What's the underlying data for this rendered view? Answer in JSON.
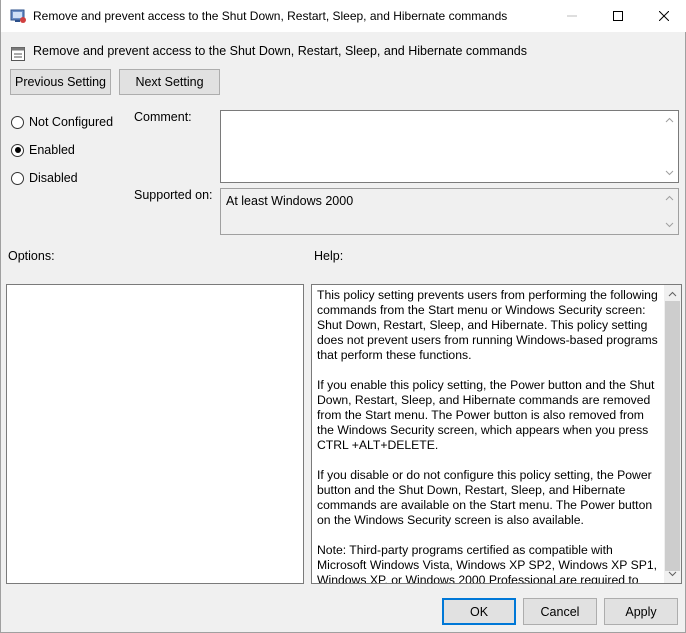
{
  "window": {
    "title": "Remove and prevent access to the Shut Down, Restart, Sleep, and Hibernate commands"
  },
  "header": {
    "title": "Remove and prevent access to the Shut Down, Restart, Sleep, and Hibernate commands"
  },
  "nav": {
    "previous_label": "Previous Setting",
    "next_label": "Next Setting"
  },
  "state": {
    "options": [
      {
        "label": "Not Configured",
        "checked": false
      },
      {
        "label": "Enabled",
        "checked": true
      },
      {
        "label": "Disabled",
        "checked": false
      }
    ]
  },
  "comment": {
    "label": "Comment:",
    "value": ""
  },
  "supported": {
    "label": "Supported on:",
    "value": "At least Windows 2000"
  },
  "options_panel": {
    "label": "Options:"
  },
  "help": {
    "label": "Help:",
    "paragraphs": [
      "This policy setting prevents users from performing the following commands from the Start menu or Windows Security screen: Shut Down, Restart, Sleep, and Hibernate. This policy setting does not prevent users from running Windows-based programs that perform these functions.",
      "If you enable this policy setting, the Power button and the Shut Down, Restart, Sleep, and Hibernate commands are removed from the Start menu. The Power button is also removed from the Windows Security screen, which appears when you press CTRL +ALT+DELETE.",
      "If you disable or do not configure this policy setting, the Power button and the Shut Down, Restart, Sleep, and Hibernate commands are available on the Start menu. The Power button on the Windows Security screen is also available.",
      "Note: Third-party programs certified as compatible with Microsoft Windows Vista, Windows XP SP2, Windows XP SP1, Windows XP, or Windows 2000 Professional are required to"
    ]
  },
  "footer": {
    "ok_label": "OK",
    "cancel_label": "Cancel",
    "apply_label": "Apply"
  },
  "colors": {
    "accent": "#0078d7",
    "background": "#f0f0f0"
  },
  "icons": {
    "title": "policy-icon",
    "header": "setting-icon"
  }
}
